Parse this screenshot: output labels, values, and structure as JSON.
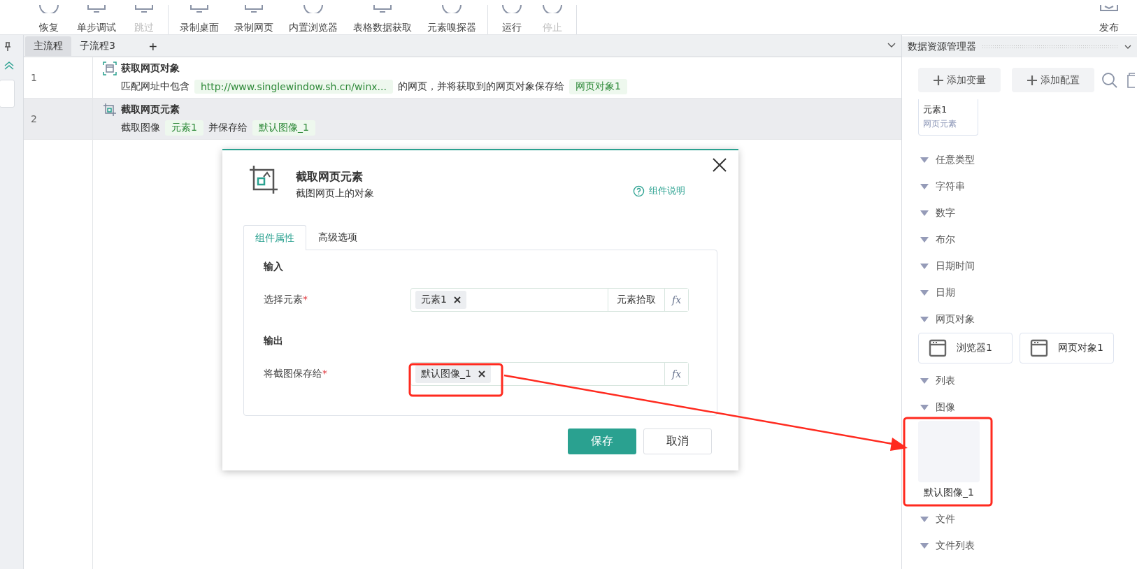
{
  "toolbar": {
    "groups": [
      [
        {
          "label": "恢复",
          "disabled": false
        },
        {
          "label": "单步调试",
          "disabled": false
        },
        {
          "label": "跳过",
          "disabled": true
        }
      ],
      [
        {
          "label": "录制桌面",
          "disabled": false
        },
        {
          "label": "录制网页",
          "disabled": false
        },
        {
          "label": "内置浏览器",
          "disabled": false
        },
        {
          "label": "表格数据获取",
          "disabled": false
        },
        {
          "label": "元素嗅探器",
          "disabled": false
        }
      ],
      [
        {
          "label": "运行",
          "disabled": false
        },
        {
          "label": "停止",
          "disabled": true
        }
      ]
    ],
    "publish": "发布"
  },
  "flow_tabs": [
    {
      "label": "主流程",
      "selected": true
    },
    {
      "label": "子流程3",
      "selected": false
    }
  ],
  "add_tab": "+",
  "steps": [
    {
      "number": "1",
      "kind": "page",
      "title": "获取网页对象",
      "selected": false,
      "parts": [
        {
          "kind": "text",
          "text": "匹配网址中包含"
        },
        {
          "kind": "tag",
          "text": "http://www.singlewindow.sh.cn/winx..."
        },
        {
          "kind": "text",
          "text": "的网页，并将获取到的网页对象保存给"
        },
        {
          "kind": "tag",
          "text": "网页对象1"
        }
      ]
    },
    {
      "number": "2",
      "kind": "crop",
      "title": "截取网页元素",
      "selected": true,
      "parts": [
        {
          "kind": "text",
          "text": "截取图像"
        },
        {
          "kind": "tag",
          "text": "元素1"
        },
        {
          "kind": "text",
          "text": "并保存给"
        },
        {
          "kind": "tag",
          "text": "默认图像_1"
        }
      ]
    }
  ],
  "dialog": {
    "title": "截取网页元素",
    "subtitle": "截图网页上的对象",
    "help": "组件说明",
    "tabs": [
      {
        "label": "组件属性",
        "selected": true
      },
      {
        "label": "高级选项",
        "selected": false
      }
    ],
    "sections": [
      {
        "heading": "输入",
        "fields": [
          {
            "label": "选择元素",
            "required_mark": "*",
            "chip": "元素1",
            "picker": "元素拾取",
            "expression_button": "fx"
          }
        ]
      },
      {
        "heading": "输出",
        "fields": [
          {
            "label": "将截图保存给",
            "required_mark": "*",
            "chip": "默认图像_1",
            "expression_button": "fx"
          }
        ]
      }
    ],
    "buttons": [
      {
        "label": "保存",
        "kind": "primary"
      },
      {
        "label": "取消",
        "kind": "secondary"
      }
    ]
  },
  "data_panel": {
    "title": "数据资源管理器",
    "buttons": [
      "添加变量",
      "添加配置"
    ],
    "top_cards": [
      {
        "name": "元素1",
        "type": "网页元素"
      }
    ],
    "groups": [
      {
        "label": "任意类型",
        "expanded": true
      },
      {
        "label": "字符串",
        "expanded": true
      },
      {
        "label": "数字",
        "expanded": true
      },
      {
        "label": "布尔",
        "expanded": true
      },
      {
        "label": "日期时间",
        "expanded": true
      },
      {
        "label": "日期",
        "expanded": true
      },
      {
        "label": "网页对象",
        "expanded": true,
        "items": [
          {
            "label": "浏览器1",
            "kind": "window"
          },
          {
            "label": "网页对象1",
            "kind": "window"
          }
        ]
      },
      {
        "label": "列表",
        "expanded": true
      },
      {
        "label": "图像",
        "expanded": true,
        "items": [
          {
            "label": "默认图像_1",
            "kind": "image"
          }
        ]
      },
      {
        "label": "文件",
        "expanded": true
      },
      {
        "label": "文件列表",
        "expanded": true
      }
    ]
  }
}
